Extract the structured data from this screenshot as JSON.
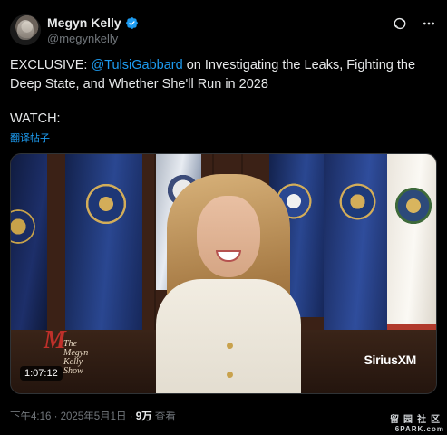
{
  "author": {
    "display_name": "Megyn Kelly",
    "handle": "@megynkelly",
    "verified_badge": "verified-badge-icon",
    "avatar": "avatar"
  },
  "header_actions": [
    "grok-icon",
    "more-icon"
  ],
  "tweet": {
    "text_prefix": "EXCLUSIVE: ",
    "mention": "@TulsiGabbard",
    "text_suffix": " on Investigating the Leaks, Fighting the Deep State, and Whether She'll Run in 2028",
    "watch": "WATCH:",
    "translate": "翻译帖子"
  },
  "media": {
    "duration": "1:07:12",
    "show_logo_line1": "The",
    "show_logo_line2": "Megyn",
    "show_logo_line3": "Kelly",
    "show_logo_line4": "Show",
    "brand": "SiriusXM"
  },
  "meta": {
    "time": "下午4:16",
    "sep1": " · ",
    "date": "2025年5月1日",
    "sep2": " · ",
    "views": "9万",
    "views_label": " 查看"
  },
  "watermark": {
    "top": "留园社区",
    "bottom": "6PARK.com"
  },
  "colors": {
    "background": "#000000",
    "text": "#e7e9ea",
    "muted": "#71767b",
    "accent": "#1d9bf0"
  }
}
